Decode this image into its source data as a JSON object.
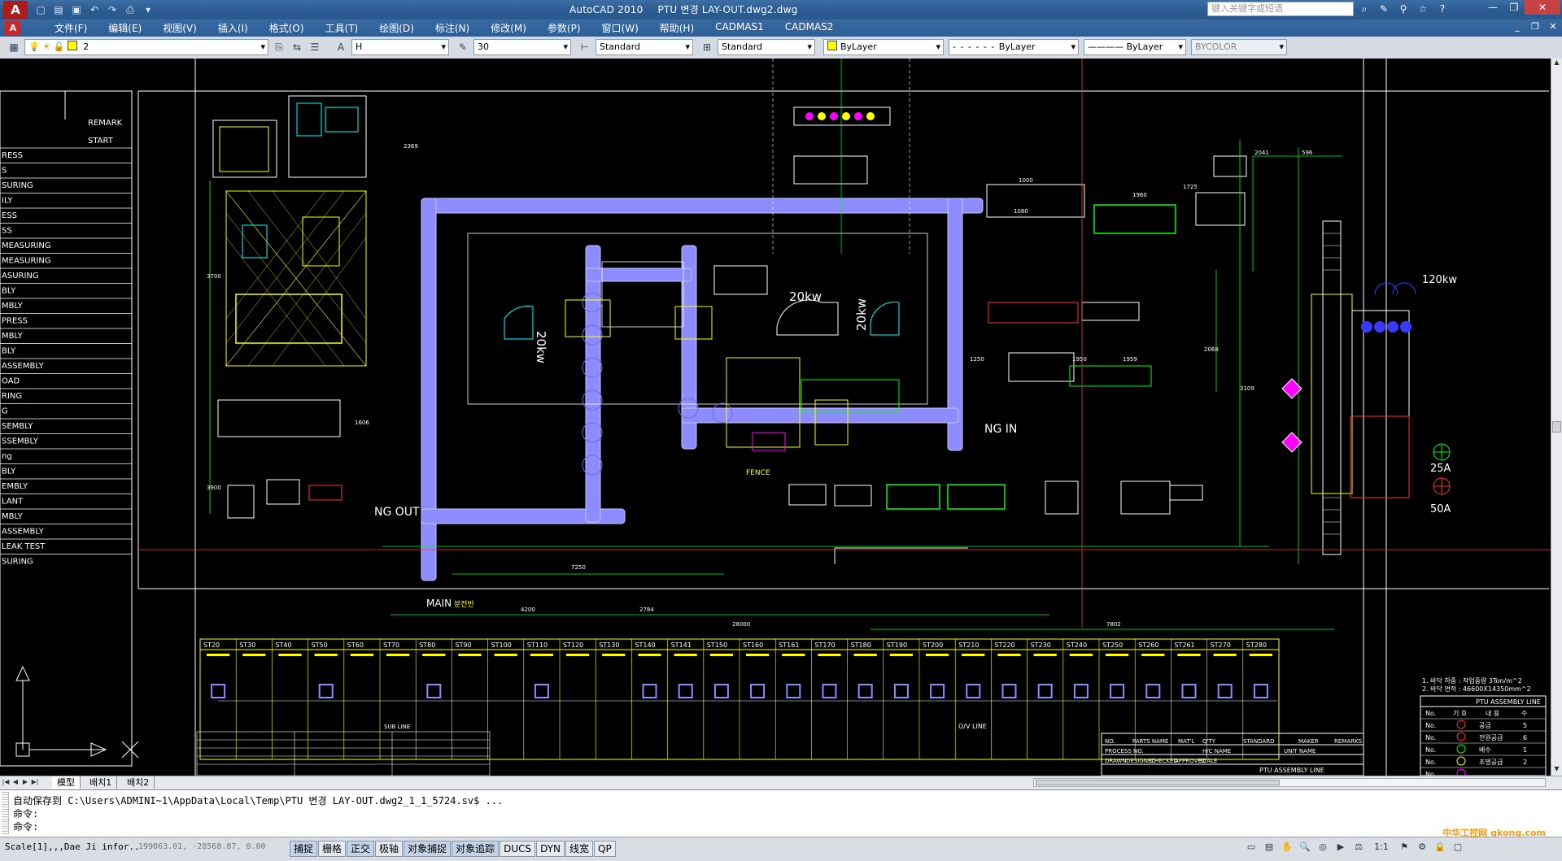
{
  "window": {
    "app_title": "AutoCAD 2010",
    "doc_title": "PTU 변경 LAY-OUT.dwg2.dwg",
    "search_placeholder": "键入关键字或短语"
  },
  "menu": [
    "文件(F)",
    "编辑(E)",
    "视图(V)",
    "插入(I)",
    "格式(O)",
    "工具(T)",
    "绘图(D)",
    "标注(N)",
    "修改(M)",
    "参数(P)",
    "窗口(W)",
    "帮助(H)",
    "CADMAS1",
    "CADMAS2"
  ],
  "toolbar": {
    "layer": "2",
    "text_style": "H",
    "text_height": "30",
    "dim_style": "Standard",
    "table_style": "Standard",
    "color": "ByLayer",
    "linetype": "ByLayer",
    "lineweight": "ByLayer",
    "plotstyle": "BYCOLOR"
  },
  "drawing": {
    "remark_table": {
      "header": [
        "REMARK",
        "START"
      ],
      "rows": [
        "RESS",
        "S",
        "SURING",
        "ILY",
        "ESS",
        "SS",
        "MEASURING",
        "MEASURING",
        "ASURING",
        "BLY",
        "MBLY",
        "PRESS",
        "MBLY",
        "BLY",
        "ASSEMBLY",
        "OAD",
        "RING",
        "G",
        "SEMBLY",
        "SSEMBLY",
        "ng",
        "BLY",
        "EMBLY",
        "LANT",
        "MBLY",
        "ASSEMBLY",
        "LEAK TEST",
        "SURING"
      ]
    },
    "labels": {
      "motor_20kw_a": "20kw",
      "motor_20kw_b": "20kw",
      "motor_20kw_c": "20kw",
      "motor_120kw": "120kw",
      "ng_out": "NG OUT",
      "ng_in": "NG IN",
      "main": "MAIN",
      "main_sub": "분전반",
      "fence": "FENCE",
      "breaker_25a": "25A",
      "breaker_50a": "50A",
      "ov_line": "O/V LINE",
      "sub_line": "SUB LINE",
      "line_title": "PTU ASSEMBLY LINE"
    },
    "dims": [
      "2369",
      "2041",
      "596",
      "1725",
      "1960",
      "3109",
      "7250",
      "4200",
      "2784",
      "28000",
      "7802",
      "1606",
      "3900",
      "3700",
      "2068",
      "1080",
      "1250",
      "1950",
      "1959",
      "1000"
    ],
    "stations": [
      "ST20",
      "ST30",
      "ST40",
      "ST50",
      "ST60",
      "ST70",
      "ST80",
      "ST90",
      "ST100",
      "ST110",
      "ST120",
      "ST130",
      "ST140",
      "ST141",
      "ST150",
      "ST160",
      "ST161",
      "ST170",
      "ST180",
      "ST190",
      "ST200",
      "ST210",
      "ST220",
      "ST230",
      "ST240",
      "ST250",
      "ST260",
      "ST261",
      "ST270",
      "ST280"
    ],
    "notes": [
      "1. 바닥 하중 : 작업중량 3Ton/m^2",
      "2. 바닥 면적 : 46600X14350mm^2"
    ],
    "legend": {
      "title": "PTU ASSEMBLY LINE",
      "headers": [
        "No.",
        "기 호",
        "내 용",
        "수"
      ],
      "rows": [
        {
          "no": "No.",
          "desc": "공급",
          "qty": "5"
        },
        {
          "no": "No.",
          "desc": "전원공급",
          "qty": "6"
        },
        {
          "no": "No.",
          "desc": "배수",
          "qty": "1"
        },
        {
          "no": "No.",
          "desc": "조명공급",
          "qty": "2"
        },
        {
          "no": "No.",
          "desc": "",
          "qty": ""
        }
      ]
    },
    "title_block": {
      "row1": [
        "NO.",
        "PARTS NAME",
        "MAT'L",
        "Q'TY",
        "STANDARD",
        "MAKER",
        "REMARKS"
      ],
      "row2": [
        "PROCESS NO.",
        "H/C NAME",
        "UNIT NAME"
      ],
      "row3": [
        "DRAWN",
        "DESIGNED",
        "CHECKED",
        "APPROVED",
        "SCALE"
      ],
      "title": "PTU ASSEMBLY LINE"
    }
  },
  "layout_tabs": [
    "模型",
    "배치1",
    "배치2"
  ],
  "command": {
    "line1": "自动保存到 C:\\Users\\ADMINI~1\\AppData\\Local\\Temp\\PTU 변경 LAY-OUT.dwg2_1_1_5724.sv$ ...",
    "line2": "命令:",
    "line3": "命令:"
  },
  "status": {
    "left": "Scale[1],,,Dae Ji infor..",
    "coords": "199063.01, -28568.87, 0.00",
    "toggles": [
      "捕捉",
      "栅格",
      "正交",
      "极轴",
      "对象捕捉",
      "对象追踪",
      "DUCS",
      "DYN",
      "线宽",
      "QP"
    ],
    "annotation_scale": "1:1"
  },
  "watermark": "中华工控网 gkong.com"
}
